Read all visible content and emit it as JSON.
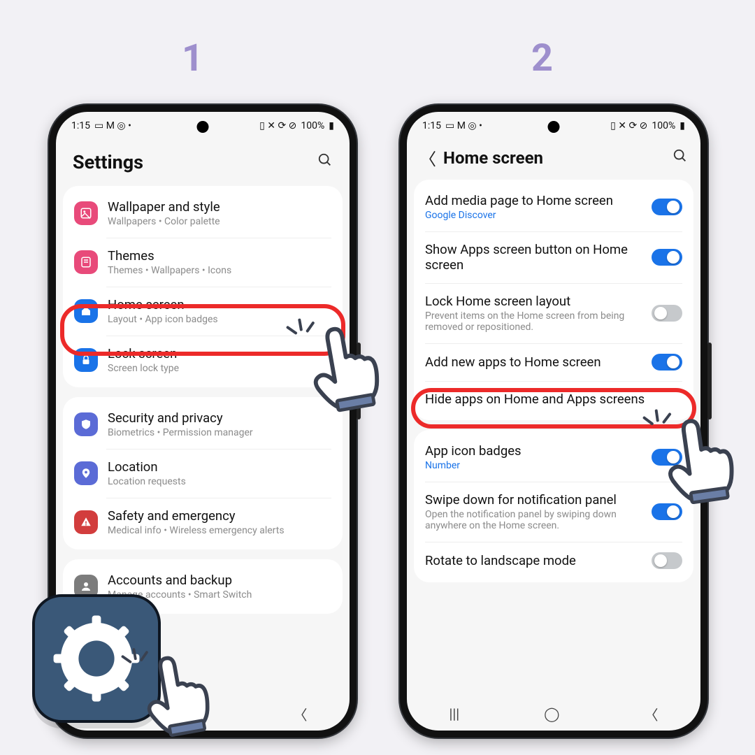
{
  "steps": {
    "one": "1",
    "two": "2"
  },
  "status": {
    "time": "1:15",
    "battery": "100%",
    "indicators": "▢ ✕ ⟳ ⊘"
  },
  "phone1": {
    "title": "Settings",
    "groups": [
      {
        "items": [
          {
            "icon": "wallpaper",
            "title": "Wallpaper and style",
            "sub": "Wallpapers  •  Color palette"
          },
          {
            "icon": "themes",
            "title": "Themes",
            "sub": "Themes  •  Wallpapers  •  Icons"
          },
          {
            "icon": "home",
            "title": "Home screen",
            "sub": "Layout  •  App icon badges",
            "highlight": true
          },
          {
            "icon": "lock",
            "title": "Lock screen",
            "sub": "Screen lock type"
          }
        ]
      },
      {
        "items": [
          {
            "icon": "security",
            "title": "Security and privacy",
            "sub": "Biometrics  •  Permission manager"
          },
          {
            "icon": "location",
            "title": "Location",
            "sub": "Location requests"
          },
          {
            "icon": "safety",
            "title": "Safety and emergency",
            "sub": "Medical info  •  Wireless emergency alerts"
          }
        ]
      },
      {
        "items": [
          {
            "icon": "accounts",
            "title": "Accounts and backup",
            "sub": "Manage accounts  •  Smart Switch"
          }
        ]
      }
    ]
  },
  "phone2": {
    "title": "Home screen",
    "groups": [
      {
        "items": [
          {
            "title": "Add media page to Home screen",
            "sub": "Google Discover",
            "subBlue": true,
            "toggle": true
          },
          {
            "title": "Show Apps screen button on Home screen",
            "toggle": true
          },
          {
            "title": "Lock Home screen layout",
            "sub": "Prevent items on the Home screen from being removed or repositioned.",
            "toggle": false
          },
          {
            "title": "Add new apps to Home screen",
            "toggle": true,
            "highlight": true
          },
          {
            "title": "Hide apps on Home and Apps screens"
          }
        ]
      },
      {
        "items": [
          {
            "title": "App icon badges",
            "sub": "Number",
            "subBlue": true,
            "toggle": true
          },
          {
            "title": "Swipe down for notification panel",
            "sub": "Open the notification panel by swiping down anywhere on the Home screen.",
            "toggle": true
          },
          {
            "title": "Rotate to landscape mode",
            "toggle": false
          }
        ]
      }
    ]
  },
  "colors": {
    "wallpaper": "#e84a7a",
    "themes": "#e84a7a",
    "home": "#1a73e8",
    "lock": "#1a73e8",
    "security": "#5b6bd6",
    "location": "#5b6bd6",
    "safety": "#d23d3d",
    "accounts": "#7c7c7c"
  }
}
